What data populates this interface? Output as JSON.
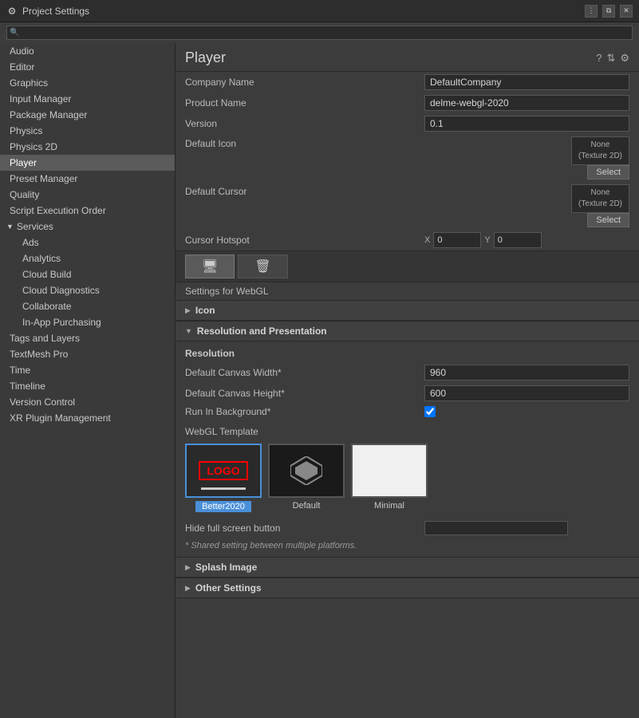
{
  "titleBar": {
    "icon": "⚙",
    "title": "Project Settings",
    "buttons": [
      "⋮",
      "⧉",
      "✕"
    ]
  },
  "search": {
    "placeholder": ""
  },
  "sidebar": {
    "items": [
      {
        "label": "Audio",
        "indent": 0,
        "active": false
      },
      {
        "label": "Editor",
        "indent": 0,
        "active": false
      },
      {
        "label": "Graphics",
        "indent": 0,
        "active": false
      },
      {
        "label": "Input Manager",
        "indent": 0,
        "active": false
      },
      {
        "label": "Package Manager",
        "indent": 0,
        "active": false
      },
      {
        "label": "Physics",
        "indent": 0,
        "active": false
      },
      {
        "label": "Physics 2D",
        "indent": 0,
        "active": false
      },
      {
        "label": "Player",
        "indent": 0,
        "active": true
      },
      {
        "label": "Preset Manager",
        "indent": 0,
        "active": false
      },
      {
        "label": "Quality",
        "indent": 0,
        "active": false
      },
      {
        "label": "Script Execution Order",
        "indent": 0,
        "active": false
      },
      {
        "label": "Services",
        "indent": 0,
        "active": false,
        "group": true
      },
      {
        "label": "Ads",
        "indent": 1,
        "active": false
      },
      {
        "label": "Analytics",
        "indent": 1,
        "active": false
      },
      {
        "label": "Cloud Build",
        "indent": 1,
        "active": false
      },
      {
        "label": "Cloud Diagnostics",
        "indent": 1,
        "active": false
      },
      {
        "label": "Collaborate",
        "indent": 1,
        "active": false
      },
      {
        "label": "In-App Purchasing",
        "indent": 1,
        "active": false
      },
      {
        "label": "Tags and Layers",
        "indent": 0,
        "active": false
      },
      {
        "label": "TextMesh Pro",
        "indent": 0,
        "active": false
      },
      {
        "label": "Time",
        "indent": 0,
        "active": false
      },
      {
        "label": "Timeline",
        "indent": 0,
        "active": false
      },
      {
        "label": "Version Control",
        "indent": 0,
        "active": false
      },
      {
        "label": "XR Plugin Management",
        "indent": 0,
        "active": false
      }
    ]
  },
  "panel": {
    "title": "Player",
    "headerIcons": [
      "?",
      "⇅",
      "⚙"
    ],
    "fields": {
      "companyName": {
        "label": "Company Name",
        "value": "DefaultCompany"
      },
      "productName": {
        "label": "Product Name",
        "value": "delme-webgl-2020"
      },
      "version": {
        "label": "Version",
        "value": "0.1"
      },
      "defaultIcon": {
        "label": "Default Icon",
        "textureLabel": "None\n(Texture 2D)",
        "selectBtn": "Select"
      },
      "defaultCursor": {
        "label": "Default Cursor",
        "textureLabel": "None\n(Texture 2D)",
        "selectBtn": "Select"
      },
      "cursorHotspot": {
        "label": "Cursor Hotspot",
        "x": "0",
        "y": "0"
      }
    },
    "platformTabs": [
      {
        "label": "🖥",
        "active": true
      },
      {
        "label": "🗑",
        "active": false
      }
    ],
    "webglLabel": "Settings for WebGL",
    "sections": [
      {
        "id": "icon",
        "label": "Icon",
        "collapsed": true,
        "arrow": "▶"
      },
      {
        "id": "resolution",
        "label": "Resolution and Presentation",
        "collapsed": false,
        "arrow": "▼",
        "subsections": [
          {
            "title": "Resolution",
            "fields": [
              {
                "label": "Default Canvas Width*",
                "value": "960"
              },
              {
                "label": "Default Canvas Height*",
                "value": "600"
              },
              {
                "label": "Run In Background*",
                "type": "checkbox",
                "checked": true
              }
            ]
          },
          {
            "title": "WebGL Template",
            "templates": [
              {
                "name": "Better2020",
                "selected": true,
                "type": "logo"
              },
              {
                "name": "Default",
                "selected": false,
                "type": "default"
              },
              {
                "name": "Minimal",
                "selected": false,
                "type": "minimal"
              }
            ]
          },
          {
            "title": "Hide full screen button",
            "type": "toggle"
          }
        ],
        "note": "* Shared setting between multiple platforms."
      },
      {
        "id": "splash",
        "label": "Splash Image",
        "collapsed": true,
        "arrow": "▶"
      },
      {
        "id": "other",
        "label": "Other Settings",
        "collapsed": true,
        "arrow": "▶"
      }
    ]
  }
}
